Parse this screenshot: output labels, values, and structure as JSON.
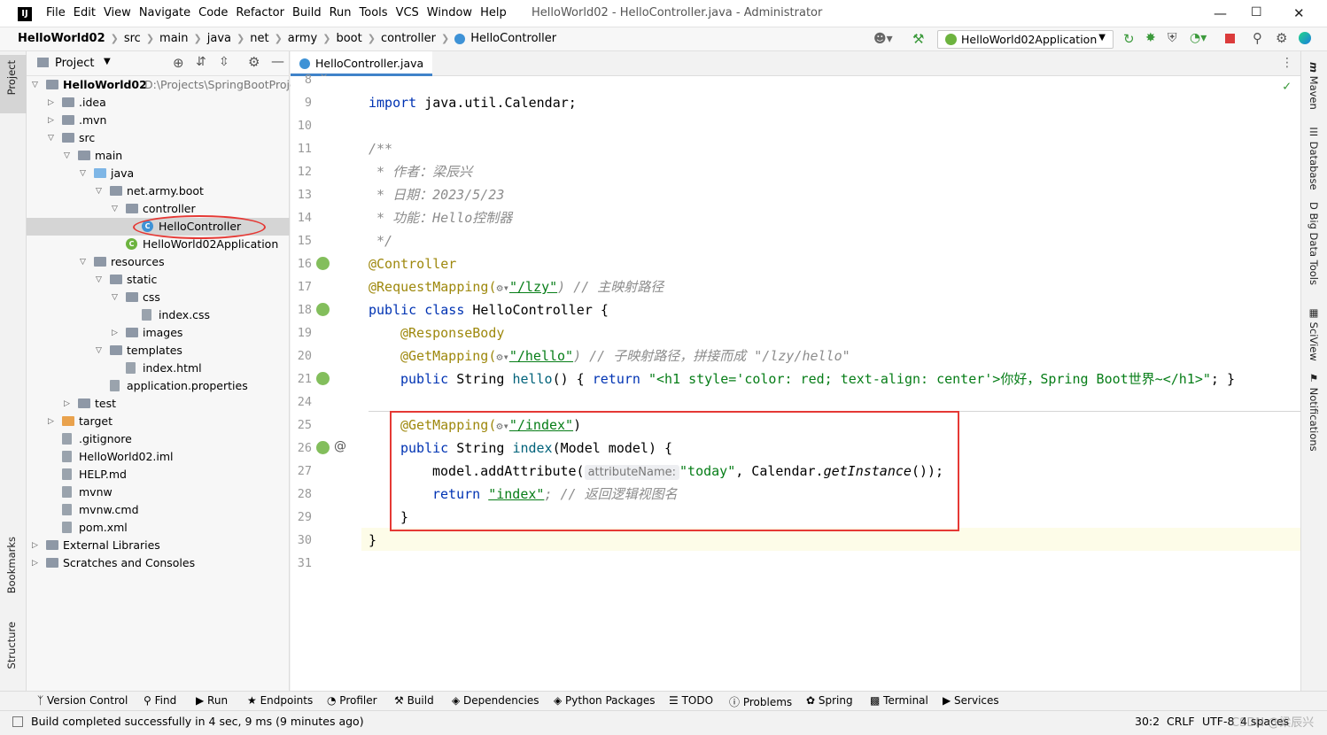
{
  "window": {
    "menus": [
      "File",
      "Edit",
      "View",
      "Navigate",
      "Code",
      "Refactor",
      "Build",
      "Run",
      "Tools",
      "VCS",
      "Window",
      "Help"
    ],
    "title": "HelloWorld02 - HelloController.java - Administrator"
  },
  "breadcrumbs": [
    "HelloWorld02",
    "src",
    "main",
    "java",
    "net",
    "army",
    "boot",
    "controller",
    "HelloController"
  ],
  "run_config": "HelloWorld02Application",
  "project_panel": {
    "title": "Project",
    "root_path": "D:\\Projects\\SpringBootProje",
    "tree": [
      {
        "label": "HelloWorld02",
        "depth": 0,
        "icon": "folder",
        "open": true
      },
      {
        "label": ".idea",
        "depth": 1,
        "icon": "folder",
        "open": false
      },
      {
        "label": ".mvn",
        "depth": 1,
        "icon": "folder",
        "open": false
      },
      {
        "label": "src",
        "depth": 1,
        "icon": "folder",
        "open": true
      },
      {
        "label": "main",
        "depth": 2,
        "icon": "folder",
        "open": true
      },
      {
        "label": "java",
        "depth": 3,
        "icon": "source-folder",
        "open": true
      },
      {
        "label": "net.army.boot",
        "depth": 4,
        "icon": "package",
        "open": true
      },
      {
        "label": "controller",
        "depth": 5,
        "icon": "package",
        "open": true
      },
      {
        "label": "HelloController",
        "depth": 6,
        "icon": "class",
        "selected": true
      },
      {
        "label": "HelloWorld02Application",
        "depth": 5,
        "icon": "spring-class"
      },
      {
        "label": "resources",
        "depth": 3,
        "icon": "resource-folder",
        "open": true
      },
      {
        "label": "static",
        "depth": 4,
        "icon": "folder",
        "open": true
      },
      {
        "label": "css",
        "depth": 5,
        "icon": "folder",
        "open": true
      },
      {
        "label": "index.css",
        "depth": 6,
        "icon": "css-file"
      },
      {
        "label": "images",
        "depth": 5,
        "icon": "folder",
        "open": false
      },
      {
        "label": "templates",
        "depth": 4,
        "icon": "folder",
        "open": true
      },
      {
        "label": "index.html",
        "depth": 5,
        "icon": "html-file"
      },
      {
        "label": "application.properties",
        "depth": 4,
        "icon": "properties-file"
      },
      {
        "label": "test",
        "depth": 2,
        "icon": "folder",
        "open": false
      },
      {
        "label": "target",
        "depth": 1,
        "icon": "excluded-folder",
        "open": false
      },
      {
        "label": ".gitignore",
        "depth": 1,
        "icon": "file"
      },
      {
        "label": "HelloWorld02.iml",
        "depth": 1,
        "icon": "file"
      },
      {
        "label": "HELP.md",
        "depth": 1,
        "icon": "md-file"
      },
      {
        "label": "mvnw",
        "depth": 1,
        "icon": "file"
      },
      {
        "label": "mvnw.cmd",
        "depth": 1,
        "icon": "file"
      },
      {
        "label": "pom.xml",
        "depth": 1,
        "icon": "maven-file"
      },
      {
        "label": "External Libraries",
        "depth": 0,
        "icon": "library",
        "open": false
      },
      {
        "label": "Scratches and Consoles",
        "depth": 0,
        "icon": "scratch",
        "open": false
      }
    ]
  },
  "editor": {
    "tab": "HelloController.java",
    "line_numbers": [
      "8",
      "9",
      "10",
      "11",
      "12",
      "13",
      "14",
      "15",
      "16",
      "17",
      "18",
      "19",
      "20",
      "21",
      "24",
      "25",
      "26",
      "27",
      "28",
      "29",
      "30",
      "31"
    ],
    "code": {
      "l9a": "import",
      "l9b": " java.util.Calendar;",
      "l11": "/**",
      "l12": " * 作者：梁辰兴",
      "l13": " * 日期：2023/5/23",
      "l14": " * 功能：Hello控制器",
      "l15": " */",
      "l16": "@Controller",
      "l17a": "@RequestMapping(",
      "l17b": "\"/lzy\"",
      "l17c": ") // 主映射路径",
      "l18a": "public class",
      "l18b": " HelloController {",
      "l19": "@ResponseBody",
      "l20a": "@GetMapping(",
      "l20b": "\"/hello\"",
      "l20c": ") // 子映射路径，拼接而成 \"/lzy/hello\"",
      "l21a": "public",
      "l21b": " String ",
      "l21c": "hello",
      "l21d": "() { ",
      "l21e": "return",
      "l21f": " \"<h1 style='color: red; text-align: center'>你好，Spring Boot世界~</h1>\"",
      "l21g": "; }",
      "l25a": "@GetMapping(",
      "l25b": "\"/index\"",
      "l25c": ")",
      "l26a": "public",
      "l26b": " String ",
      "l26c": "index",
      "l26d": "(Model model) {",
      "l27a": "model.addAttribute(",
      "l27hint": "attributeName:",
      "l27b": "\"today\"",
      "l27c": ", Calendar.",
      "l27d": "getInstance",
      "l27e": "());",
      "l28a": "return",
      "l28b": "\"index\"",
      "l28c": "; // 返回逻辑视图名",
      "l29": "}",
      "l30": "}"
    }
  },
  "left_tabs": [
    "Project",
    "Bookmarks",
    "Structure"
  ],
  "right_tabs": [
    "Maven",
    "Database",
    "Big Data Tools",
    "SciView",
    "Notifications"
  ],
  "tool_windows": [
    "Version Control",
    "Find",
    "Run",
    "Endpoints",
    "Profiler",
    "Build",
    "Dependencies",
    "Python Packages",
    "TODO",
    "Problems",
    "Spring",
    "Terminal",
    "Services"
  ],
  "status": {
    "message": "Build completed successfully in 4 sec, 9 ms (9 minutes ago)",
    "position": "30:2",
    "line_sep": "CRLF",
    "encoding": "UTF-8",
    "indent": "4 spaces",
    "watermark": "CSDN @梁辰兴"
  },
  "colors": {
    "highlight_box": "#e53935",
    "keyword": "#0033b3",
    "string": "#067d17",
    "annotation": "#9e880d",
    "comment": "#8c8c8c",
    "selection_circle": "#e53935"
  }
}
